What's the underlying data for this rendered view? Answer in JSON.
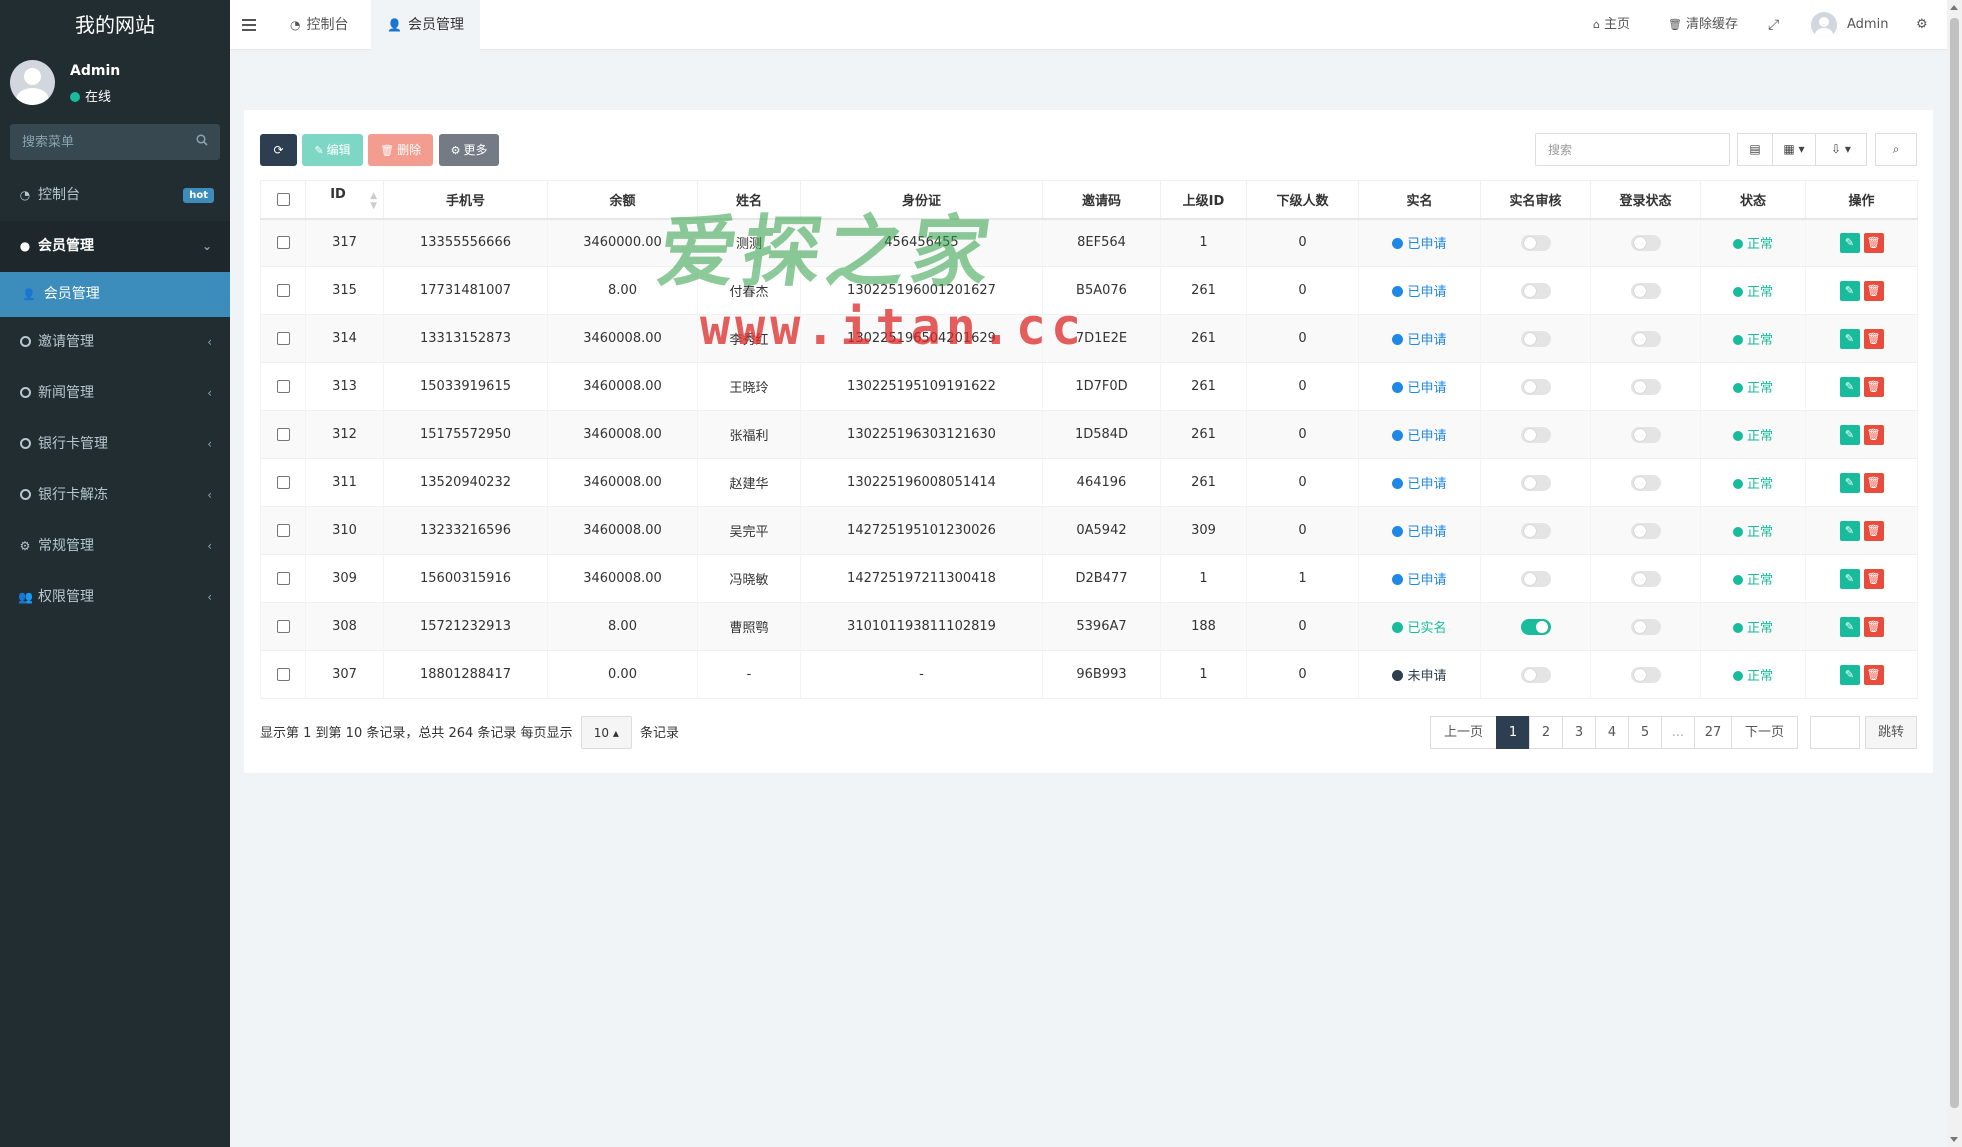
{
  "sidebar": {
    "brand": "我的网站",
    "user": {
      "name": "Admin",
      "status": "在线"
    },
    "search_placeholder": "搜索菜单",
    "items": [
      {
        "label": "控制台",
        "badge": "hot"
      },
      {
        "label": "会员管理"
      },
      {
        "label": "邀请管理"
      },
      {
        "label": "新闻管理"
      },
      {
        "label": "银行卡管理"
      },
      {
        "label": "银行卡解冻"
      },
      {
        "label": "常规管理"
      },
      {
        "label": "权限管理"
      }
    ],
    "sub_item": "会员管理"
  },
  "header": {
    "tabs": [
      {
        "label": "控制台"
      },
      {
        "label": "会员管理"
      }
    ],
    "home": "主页",
    "clear_cache": "清除缓存",
    "user": "Admin"
  },
  "toolbar": {
    "edit": "编辑",
    "delete": "删除",
    "more": "更多",
    "search_placeholder": "搜索"
  },
  "table": {
    "headers": [
      "ID",
      "手机号",
      "余额",
      "姓名",
      "身份证",
      "邀请码",
      "上级ID",
      "下级人数",
      "实名",
      "实名审核",
      "登录状态",
      "状态",
      "操作"
    ],
    "rows": [
      {
        "id": "317",
        "phone": "13355556666",
        "balance": "3460000.00",
        "name": "测测",
        "idcard": "456456455",
        "invite": "8EF564",
        "parent": "1",
        "children": "0",
        "realname": "已申请",
        "rn_color": "#1f88e5",
        "audit": false,
        "login": false,
        "status": "正常"
      },
      {
        "id": "315",
        "phone": "17731481007",
        "balance": "8.00",
        "name": "付春杰",
        "idcard": "130225196001201627",
        "invite": "B5A076",
        "parent": "261",
        "children": "0",
        "realname": "已申请",
        "rn_color": "#1f88e5",
        "audit": false,
        "login": false,
        "status": "正常"
      },
      {
        "id": "314",
        "phone": "13313152873",
        "balance": "3460008.00",
        "name": "李秀红",
        "idcard": "130225196504201629",
        "invite": "7D1E2E",
        "parent": "261",
        "children": "0",
        "realname": "已申请",
        "rn_color": "#1f88e5",
        "audit": false,
        "login": false,
        "status": "正常"
      },
      {
        "id": "313",
        "phone": "15033919615",
        "balance": "3460008.00",
        "name": "王晓玲",
        "idcard": "130225195109191622",
        "invite": "1D7F0D",
        "parent": "261",
        "children": "0",
        "realname": "已申请",
        "rn_color": "#1f88e5",
        "audit": false,
        "login": false,
        "status": "正常"
      },
      {
        "id": "312",
        "phone": "15175572950",
        "balance": "3460008.00",
        "name": "张福利",
        "idcard": "130225196303121630",
        "invite": "1D584D",
        "parent": "261",
        "children": "0",
        "realname": "已申请",
        "rn_color": "#1f88e5",
        "audit": false,
        "login": false,
        "status": "正常"
      },
      {
        "id": "311",
        "phone": "13520940232",
        "balance": "3460008.00",
        "name": "赵建华",
        "idcard": "130225196008051414",
        "invite": "464196",
        "parent": "261",
        "children": "0",
        "realname": "已申请",
        "rn_color": "#1f88e5",
        "audit": false,
        "login": false,
        "status": "正常"
      },
      {
        "id": "310",
        "phone": "13233216596",
        "balance": "3460008.00",
        "name": "吴完平",
        "idcard": "142725195101230026",
        "invite": "0A5942",
        "parent": "309",
        "children": "0",
        "realname": "已申请",
        "rn_color": "#1f88e5",
        "audit": false,
        "login": false,
        "status": "正常"
      },
      {
        "id": "309",
        "phone": "15600315916",
        "balance": "3460008.00",
        "name": "冯晓敏",
        "idcard": "142725197211300418",
        "invite": "D2B477",
        "parent": "1",
        "children": "1",
        "realname": "已申请",
        "rn_color": "#1f88e5",
        "audit": false,
        "login": false,
        "status": "正常"
      },
      {
        "id": "308",
        "phone": "15721232913",
        "balance": "8.00",
        "name": "曹照鹗",
        "idcard": "310101193811102819",
        "invite": "5396A7",
        "parent": "188",
        "children": "0",
        "realname": "已实名",
        "rn_color": "#18bc9c",
        "audit": true,
        "login": false,
        "status": "正常"
      },
      {
        "id": "307",
        "phone": "18801288417",
        "balance": "0.00",
        "name": "-",
        "idcard": "-",
        "invite": "96B993",
        "parent": "1",
        "children": "0",
        "realname": "未申请",
        "rn_color": "#2c3e50",
        "audit": false,
        "login": false,
        "status": "正常"
      }
    ]
  },
  "pagination": {
    "info_prefix": "显示第 1 到第 10 条记录，总共 264 条记录 每页显示",
    "page_size": "10",
    "info_suffix": "条记录",
    "prev": "上一页",
    "pages": [
      "1",
      "2",
      "3",
      "4",
      "5",
      "...",
      "27"
    ],
    "next": "下一页",
    "jump": "跳转"
  },
  "watermark": {
    "cn": "爱探之家",
    "url": "www.itan.cc"
  },
  "colors": {
    "sidebar_bg": "#222d32",
    "accent": "#3c8dbc",
    "success": "#18bc9c",
    "danger": "#e74c3c",
    "primary_dark": "#2c3e50"
  }
}
